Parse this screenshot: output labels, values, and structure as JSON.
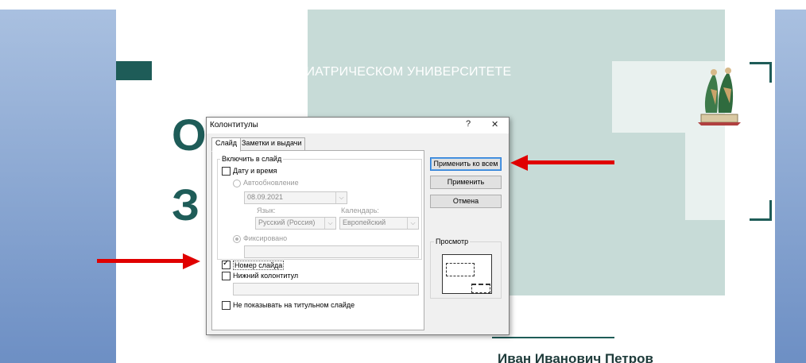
{
  "slide": {
    "subtitle": "ОБРАЗОВАНИЕ В ПЕДИАТРИЧЕСКОМ УНИВЕРСИТЕТЕ",
    "big_letter_1": "О",
    "big_letter_2": "З",
    "author": "Иван Иванович Петров",
    "accent_color": "#1e5c58"
  },
  "dialog": {
    "title": "Колонтитулы",
    "help_glyph": "?",
    "close_glyph": "✕",
    "tabs": [
      {
        "label": "Слайд",
        "active": true
      },
      {
        "label": "Заметки и выдачи",
        "active": false
      }
    ],
    "group_include_label": "Включить в слайд",
    "date_time": {
      "label": "Дату и время",
      "checked": false
    },
    "auto_update": {
      "label": "Автообновление",
      "selected": false
    },
    "date_value": "08.09.2021",
    "language_label": "Язык:",
    "language_value": "Русский (Россия)",
    "calendar_label": "Календарь:",
    "calendar_value": "Европейский",
    "fixed": {
      "label": "Фиксировано",
      "selected": true
    },
    "fixed_value": "",
    "slide_number": {
      "label": "Номер слайда",
      "checked": true
    },
    "footer": {
      "label": "Нижний колонтитул",
      "checked": false
    },
    "footer_value": "",
    "hide_on_title": {
      "label": "Не показывать на титульном слайде",
      "checked": false
    },
    "buttons": {
      "apply_all": "Применить ко всем",
      "apply": "Применить",
      "cancel": "Отмена"
    },
    "preview_label": "Просмотр"
  },
  "annotation_color": "#e00000"
}
